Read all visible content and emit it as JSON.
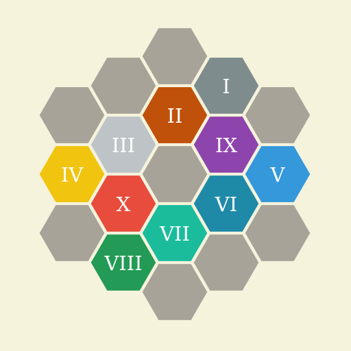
{
  "board": {
    "background": "#f5f3dc",
    "empty_color": "#a8a399",
    "cells": [
      {
        "col": 3,
        "row": 0,
        "label": "",
        "color": "#a8a399"
      },
      {
        "col": 2,
        "row": 1,
        "label": "",
        "color": "#a8a399"
      },
      {
        "col": 4,
        "row": 1,
        "label": "I",
        "color": "#7f8c8d"
      },
      {
        "col": 1,
        "row": 2,
        "label": "",
        "color": "#a8a399"
      },
      {
        "col": 3,
        "row": 2,
        "label": "II",
        "color": "#c0510a"
      },
      {
        "col": 5,
        "row": 2,
        "label": "",
        "color": "#a8a399"
      },
      {
        "col": 2,
        "row": 3,
        "label": "III",
        "color": "#bdc3c7"
      },
      {
        "col": 4,
        "row": 3,
        "label": "IX",
        "color": "#8e44ad"
      },
      {
        "col": 1,
        "row": 4,
        "label": "IV",
        "color": "#f1c40f"
      },
      {
        "col": 3,
        "row": 4,
        "label": "",
        "color": "#a8a399"
      },
      {
        "col": 5,
        "row": 4,
        "label": "V",
        "color": "#3498db"
      },
      {
        "col": 2,
        "row": 5,
        "label": "X",
        "color": "#e74c3c"
      },
      {
        "col": 4,
        "row": 5,
        "label": "VI",
        "color": "#1f8aa8"
      },
      {
        "col": 1,
        "row": 6,
        "label": "",
        "color": "#a8a399"
      },
      {
        "col": 3,
        "row": 6,
        "label": "VII",
        "color": "#1abc9c"
      },
      {
        "col": 5,
        "row": 6,
        "label": "",
        "color": "#a8a399"
      },
      {
        "col": 2,
        "row": 7,
        "label": "VIII",
        "color": "#239a55"
      },
      {
        "col": 4,
        "row": 7,
        "label": "",
        "color": "#a8a399"
      },
      {
        "col": 3,
        "row": 8,
        "label": "",
        "color": "#a8a399"
      }
    ]
  }
}
